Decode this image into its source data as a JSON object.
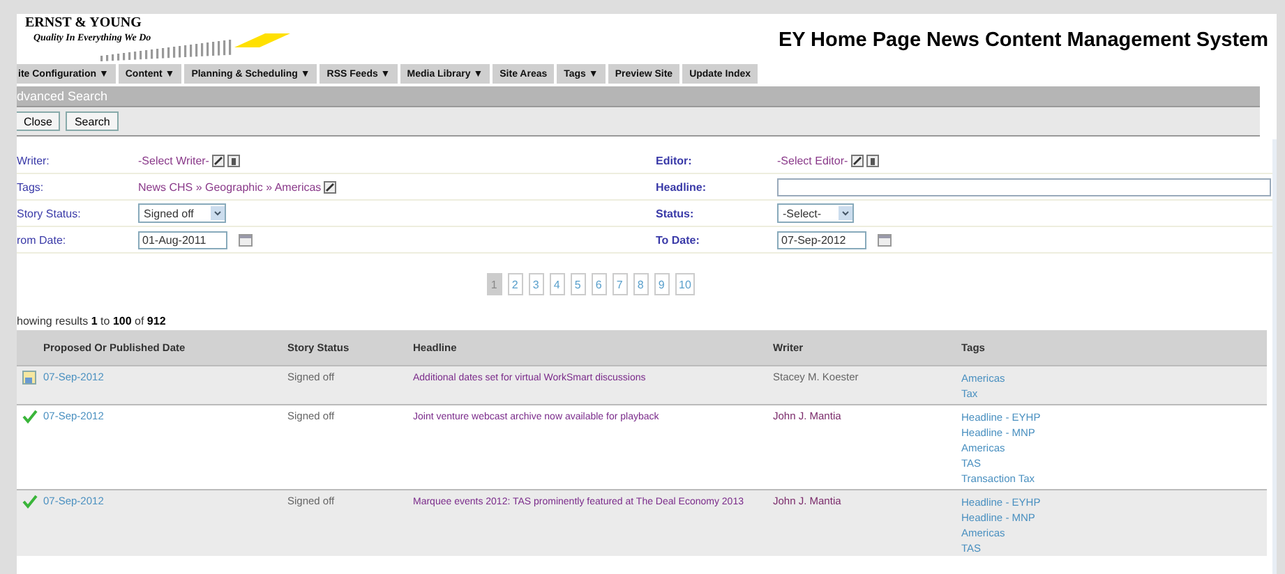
{
  "header": {
    "logo_name": "ERNST & YOUNG",
    "logo_tagline": "Quality In Everything We Do",
    "title": "EY Home Page News Content Management System"
  },
  "nav": [
    {
      "label": "ite Configuration ▼"
    },
    {
      "label": "Content ▼"
    },
    {
      "label": "Planning & Scheduling ▼"
    },
    {
      "label": "RSS Feeds ▼"
    },
    {
      "label": "Media Library ▼"
    },
    {
      "label": "Site Areas"
    },
    {
      "label": "Tags ▼"
    },
    {
      "label": "Preview Site"
    },
    {
      "label": "Update Index"
    }
  ],
  "panel_title": "dvanced Search",
  "buttons": [
    "Close",
    "Search"
  ],
  "form": [
    {
      "left": {
        "label": "Writer:",
        "kind": "picker",
        "value": "-Select Writer-"
      },
      "right": {
        "label": "Editor:",
        "kind": "picker",
        "value": "-Select Editor-"
      }
    },
    {
      "left": {
        "label": "Tags:",
        "kind": "path",
        "value": "News CHS » Geographic » Americas"
      },
      "right": {
        "label": "Headline:",
        "kind": "text"
      }
    },
    {
      "left": {
        "label": "Story Status:",
        "kind": "select",
        "value": "Signed off"
      },
      "right": {
        "label": "Status:",
        "kind": "select",
        "value": "-Select-"
      }
    },
    {
      "left": {
        "label": "rom Date:",
        "kind": "date",
        "value": "01-Aug-2011"
      },
      "right": {
        "label": "To Date:",
        "kind": "date",
        "value": "07-Sep-2012"
      }
    }
  ],
  "pages": [
    {
      "label": "1",
      "selected": true
    },
    {
      "label": "2",
      "selected": false
    },
    {
      "label": "3",
      "selected": false
    },
    {
      "label": "4",
      "selected": false
    },
    {
      "label": "5",
      "selected": false
    },
    {
      "label": "6",
      "selected": false
    },
    {
      "label": "7",
      "selected": false
    },
    {
      "label": "8",
      "selected": false
    },
    {
      "label": "9",
      "selected": false
    },
    {
      "label": "10",
      "selected": false
    }
  ],
  "results_summary": "howing results **1** to **100** of **912**",
  "table": {
    "columns": [
      "Proposed Or Published Date",
      "Story Status",
      "Headline",
      "Writer",
      "Tags"
    ],
    "rows": [
      {
        "kind": "document",
        "date": "07-Sep-2012",
        "story_status": "Signed off",
        "headline": "Additional dates set for virtual WorkSmart discussions",
        "writer": "Stacey M. Koester",
        "tags": [
          "Americas",
          "Tax"
        ]
      },
      {
        "kind": "check",
        "date": "07-Sep-2012",
        "story_status": "Signed off",
        "headline": "Joint venture webcast archive now available for playback",
        "writer": "John J. Mantia",
        "tags": [
          "Headline - EYHP",
          "Headline - MNP",
          "Americas",
          "TAS",
          "Transaction Tax"
        ]
      },
      {
        "kind": "check",
        "date": "07-Sep-2012",
        "story_status": "Signed off",
        "headline": "Marquee events 2012: TAS prominently featured at The Deal Economy 2013",
        "writer": "John J. Mantia",
        "tags": [
          "Headline - EYHP",
          "Headline - MNP",
          "Americas",
          "TAS"
        ]
      }
    ]
  }
}
